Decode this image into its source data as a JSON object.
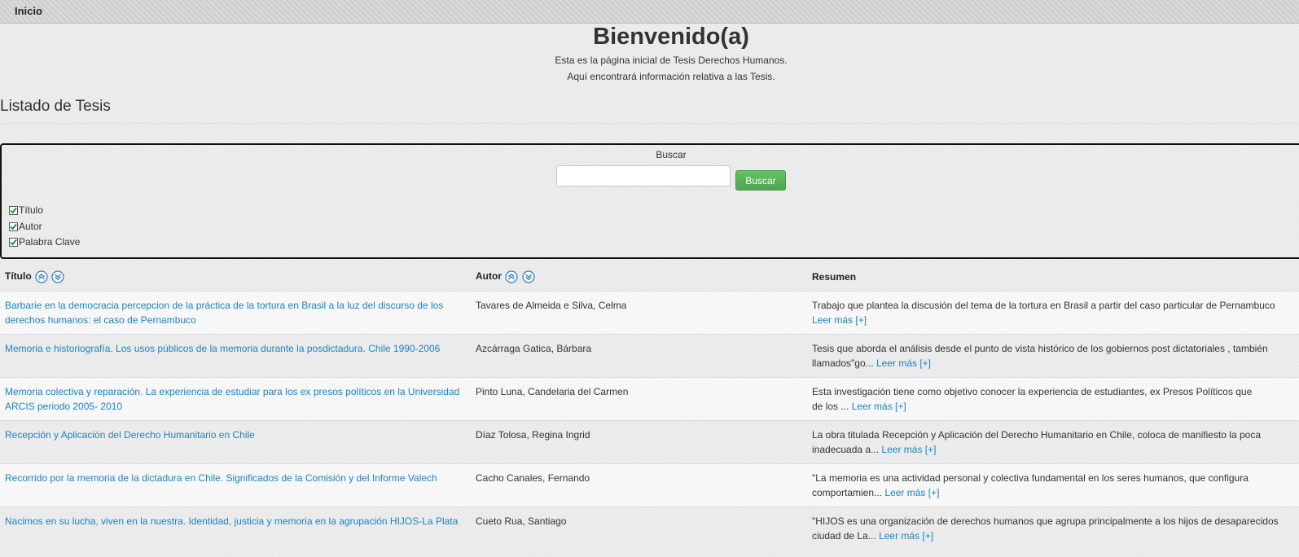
{
  "nav": {
    "home_label": "Inicio"
  },
  "header": {
    "title": "Bienvenido(a)",
    "intro_line1": "Esta es la página inicial de Tesis Derechos Humanos.",
    "intro_line2": "Aquí encontrará información relativa a las Tesis."
  },
  "listing": {
    "title": "Listado de Tesis"
  },
  "search": {
    "label": "Buscar",
    "input_value": "",
    "button_label": "Buscar",
    "filters": [
      {
        "label": "Título",
        "checked": true
      },
      {
        "label": "Autor",
        "checked": true
      },
      {
        "label": "Palabra Clave",
        "checked": true
      }
    ]
  },
  "table": {
    "headers": {
      "titulo": "Título",
      "autor": "Autor",
      "resumen": "Resumen"
    },
    "read_more_label": "Leer más [+]",
    "rows": [
      {
        "title": "Barbarie en la democracia percepcion de la práctica de la tortura en Brasil a la luz del discurso de los derechos humanos: el caso de Pernambuco",
        "author": "Tavares de Almeida e Silva, Celma",
        "summary_line1": "Trabajo que plantea la discusión del tema de la tortura en Brasil a partir del caso particular de Pernambuco",
        "summary_line2": ""
      },
      {
        "title": "Memoria e historiografía. Los usos públicos de la memoria durante la posdictadura. Chile 1990-2006",
        "author": "Azcárraga Gatica, Bárbara",
        "summary_line1": "Tesis que aborda el análisis desde el punto de vista histórico de los gobiernos post dictatoriales , también",
        "summary_line2": "llamados\"go..."
      },
      {
        "title": "Memoria colectiva y reparación. La experiencia de estudiar para los ex presos políticos en la Universidad ARCIS periodo 2005- 2010",
        "author": "Pinto Luna, Candelaria del Carmen",
        "summary_line1": "Esta investigación tiene como objetivo conocer la experiencia de estudiantes, ex Presos Políticos que",
        "summary_line2": "de los ..."
      },
      {
        "title": "Recepción y Aplicación del Derecho Humanitario en Chile",
        "author": "Díaz Tolosa, Regina Ingrid",
        "summary_line1": "La obra titulada Recepción y Aplicación del Derecho Humanitario en Chile, coloca de manifiesto la poca",
        "summary_line2": "inadecuada a..."
      },
      {
        "title": "Recorrido por la memoria de la dictadura en Chile. Significados de la Comisión y del Informe Valech",
        "author": "Cacho Canales, Fernando",
        "summary_line1": "\"La memoria es una actividad personal y colectiva fundamental en los seres humanos, que configura",
        "summary_line2": "comportamien..."
      },
      {
        "title": "Nacimos en su lucha, viven en la nuestra. Identidad, justicia y memoria en la agrupación HIJOS-La Plata",
        "author": "Cueto Rua, Santiago",
        "summary_line1": "\"HIJOS es una organización de derechos humanos que agrupa principalmente a los hijos de desaparecidos",
        "summary_line2": "ciudad de La..."
      }
    ]
  },
  "colors": {
    "link": "#1a84c6",
    "button_green": "#5bb75b",
    "background": "#ececec"
  }
}
